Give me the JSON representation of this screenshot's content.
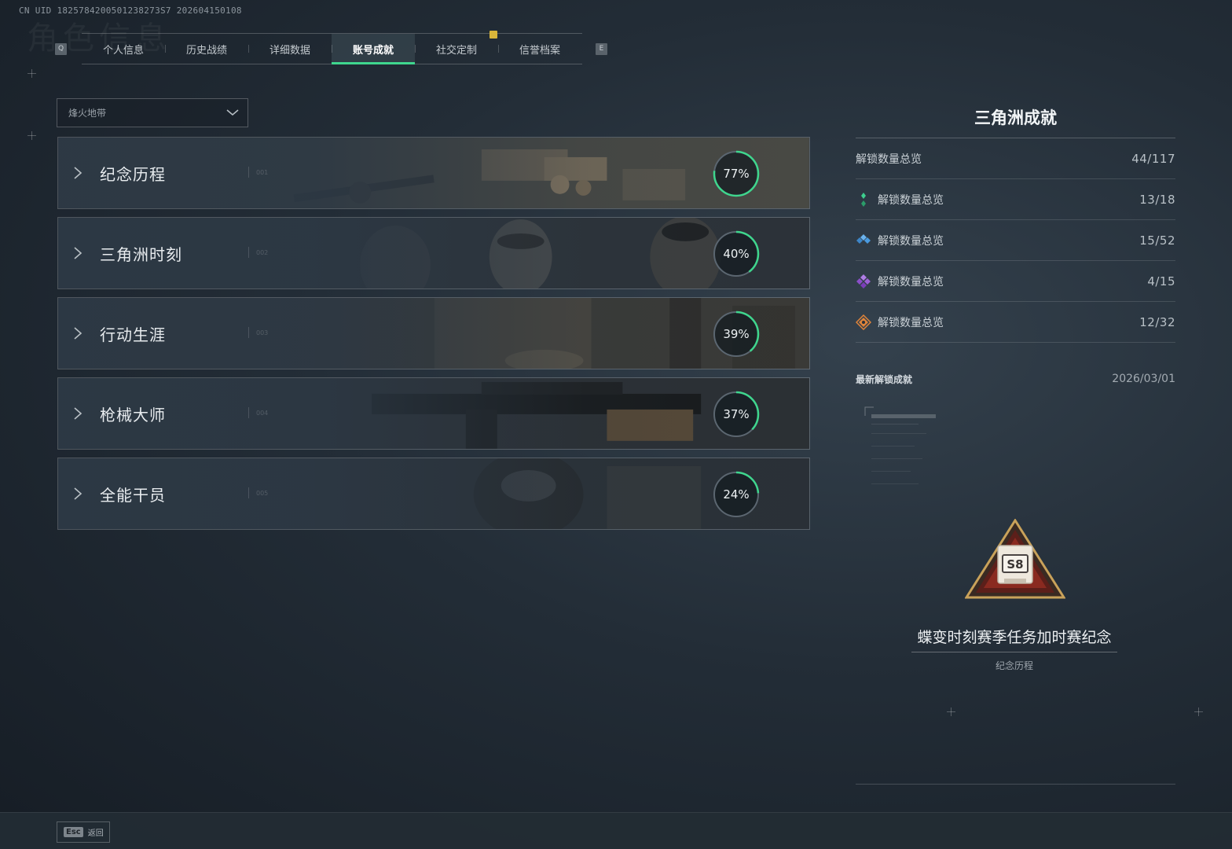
{
  "uid": "CN UID 1825784200501238273S7 202604150108",
  "ghost_title": "角色信息",
  "tabs": {
    "left_key": "Q",
    "right_key": "E",
    "items": [
      {
        "label": "个人信息"
      },
      {
        "label": "历史战绩"
      },
      {
        "label": "详细数据"
      },
      {
        "label": "账号成就"
      },
      {
        "label": "社交定制"
      },
      {
        "label": "信誉档案"
      }
    ],
    "active_index": 3
  },
  "dropdown": {
    "value": "烽火地带"
  },
  "categories": [
    {
      "label": "纪念历程",
      "num": "001",
      "percent_text": "77%",
      "percent": 77
    },
    {
      "label": "三角洲时刻",
      "num": "002",
      "percent_text": "40%",
      "percent": 40
    },
    {
      "label": "行动生涯",
      "num": "003",
      "percent_text": "39%",
      "percent": 39
    },
    {
      "label": "枪械大师",
      "num": "004",
      "percent_text": "37%",
      "percent": 37
    },
    {
      "label": "全能干员",
      "num": "005",
      "percent_text": "24%",
      "percent": 24
    }
  ],
  "panel": {
    "title": "三角洲成就",
    "stats": [
      {
        "label": "解锁数量总览",
        "value": "44/117",
        "icon": "none"
      },
      {
        "label": "解锁数量总览",
        "value": "13/18",
        "icon": "green-gem-icon",
        "color": "#3ecf8e"
      },
      {
        "label": "解锁数量总览",
        "value": "15/52",
        "icon": "blue-gem-icon",
        "color": "#4a9be0"
      },
      {
        "label": "解锁数量总览",
        "value": "4/15",
        "icon": "purple-gem-icon",
        "color": "#9c5fd6"
      },
      {
        "label": "解锁数量总览",
        "value": "12/32",
        "icon": "orange-gem-icon",
        "color": "#e0843a"
      }
    ],
    "latest_label": "最新解锁成就",
    "latest_date": "2026/03/01",
    "achievement_name": "蝶变时刻赛季任务加时赛纪念",
    "achievement_category": "纪念历程",
    "badge_text": "S8"
  },
  "footer": {
    "esc_key": "Esc",
    "esc_label": "返回"
  },
  "colors": {
    "accent": "#3fd68e",
    "ring_track": "#5b6670"
  }
}
